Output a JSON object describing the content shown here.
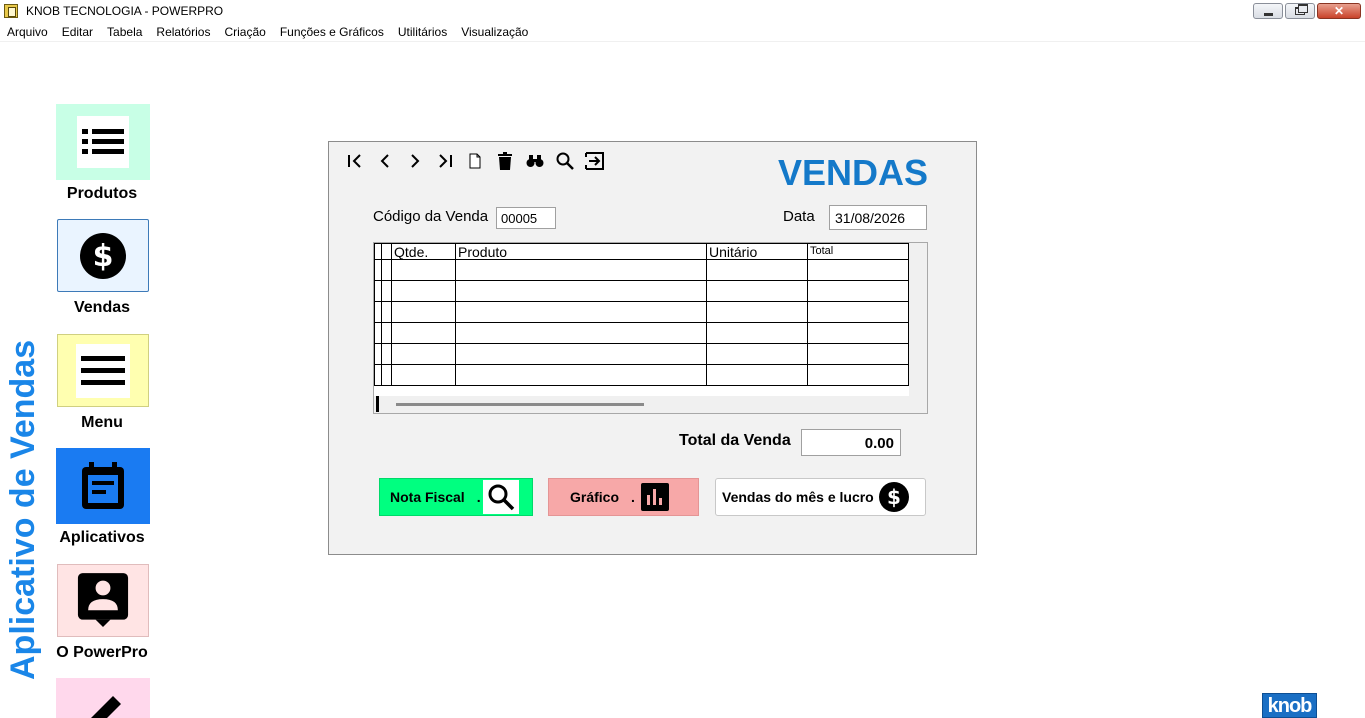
{
  "window": {
    "title": "KNOB TECNOLOGIA - POWERPRO"
  },
  "menu": [
    "Arquivo",
    "Editar",
    "Tabela",
    "Relatórios",
    "Criação",
    "Funções e Gráficos",
    "Utilitários",
    "Visualização"
  ],
  "side_title": "Aplicativo de Vendas",
  "sidebar": [
    {
      "label": "Produtos",
      "icon": "list-icon",
      "bg": "#c8ffe6"
    },
    {
      "label": "Vendas",
      "icon": "dollar-circle-icon",
      "bg": "#eaf4ff"
    },
    {
      "label": "Menu",
      "icon": "hamburger-icon",
      "bg": "#ffffb0"
    },
    {
      "label": "Aplicativos",
      "icon": "calendar-icon",
      "bg": "#1a7bf2"
    },
    {
      "label": "O PowerPro",
      "icon": "contact-icon",
      "bg": "#ffe4e4"
    },
    {
      "label": "",
      "icon": "pencil-icon",
      "bg": "#ffd8ec"
    }
  ],
  "panel": {
    "title": "VENDAS",
    "toolbar": [
      "first-record-icon",
      "prev-record-icon",
      "next-record-icon",
      "last-record-icon",
      "new-document-icon",
      "delete-icon",
      "binoculars-icon",
      "search-icon",
      "exit-icon"
    ],
    "codigo_label": "Código da Venda",
    "codigo_value": "00005",
    "data_label": "Data",
    "data_value": "31/08/2026",
    "grid": {
      "columns": [
        "Qtde.",
        "Produto",
        "Unitário",
        "Total"
      ],
      "rows": 6
    },
    "total_label": "Total da Venda",
    "total_value": "0.00",
    "buttons": {
      "nota_fiscal": "Nota Fiscal",
      "nota_fiscal_dot": ".",
      "grafico": "Gráfico",
      "grafico_dot": ".",
      "vendas_mes": "Vendas do mês e lucro"
    }
  },
  "logo": "knob",
  "colors": {
    "accent_blue": "#1479c9",
    "side_title_blue": "#1a86e8",
    "nota_green": "#00ff80",
    "grafico_pink": "#f7a8a8"
  }
}
